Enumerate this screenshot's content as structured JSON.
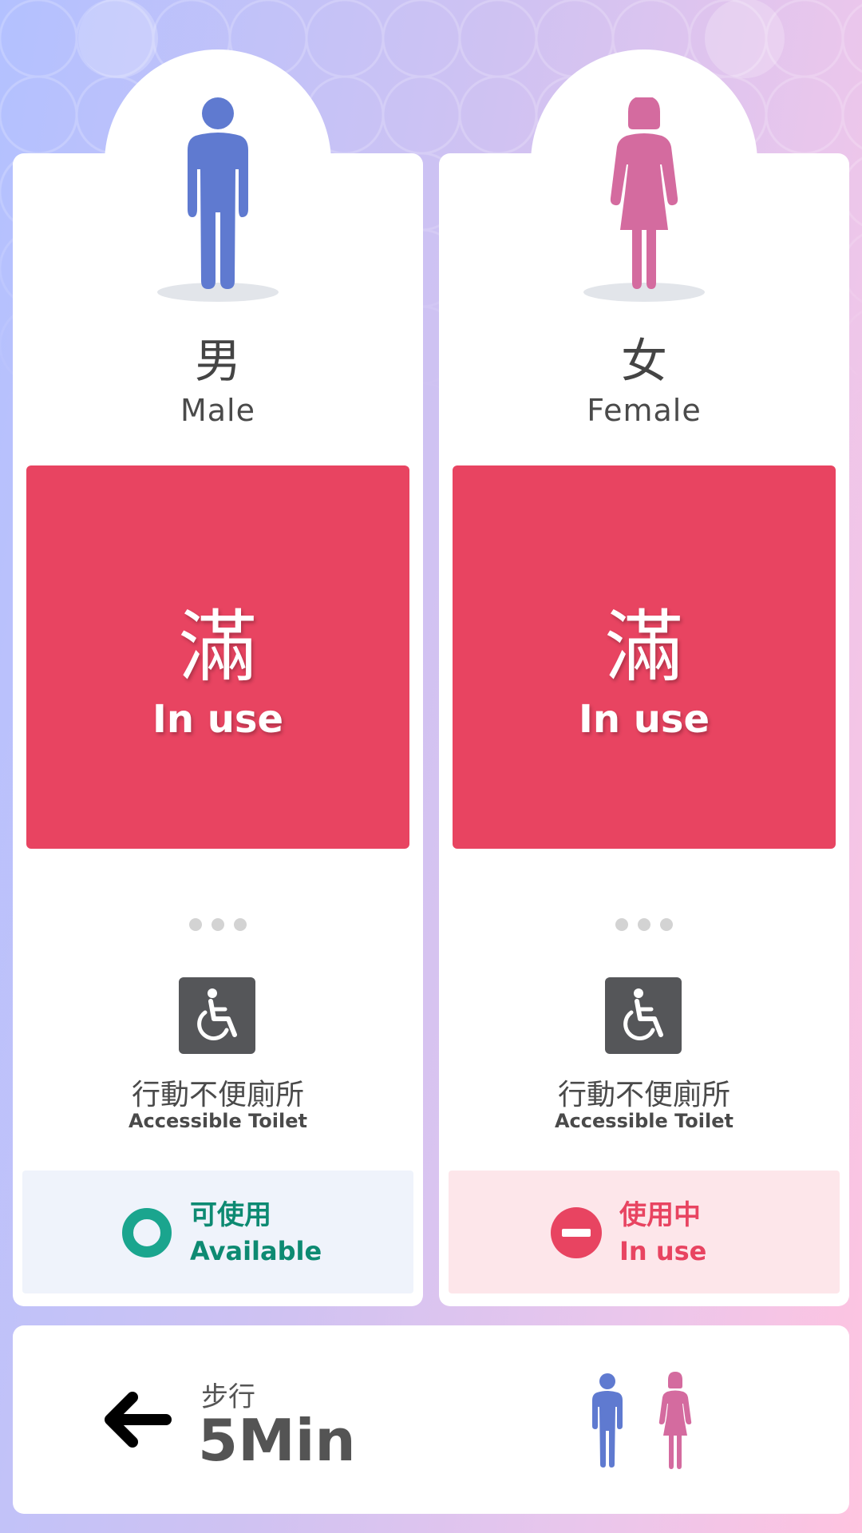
{
  "colors": {
    "male": "#5f7ad0",
    "female": "#d46b9f",
    "occupied": "#e84461",
    "available": "#1aa58e",
    "available_text": "#0d8a72",
    "available_bg": "#eff3fb",
    "inuse_bg": "#fde6ea"
  },
  "male": {
    "icon": "male-figure-icon",
    "label_zh": "男",
    "label_en": "Male",
    "status_zh": "滿",
    "status_en": "In use",
    "accessible_icon": "wheelchair-icon",
    "accessible_zh": "行動不便廁所",
    "accessible_en": "Accessible Toilet",
    "accessible_status_icon": "available-ring-icon",
    "accessible_status_zh": "可使用",
    "accessible_status_en": "Available"
  },
  "female": {
    "icon": "female-figure-icon",
    "label_zh": "女",
    "label_en": "Female",
    "status_zh": "滿",
    "status_en": "In use",
    "accessible_icon": "wheelchair-icon",
    "accessible_zh": "行動不便廁所",
    "accessible_en": "Accessible Toilet",
    "accessible_status_icon": "no-entry-icon",
    "accessible_status_zh": "使用中",
    "accessible_status_en": "In use"
  },
  "directions": {
    "arrow_icon": "left-arrow-icon",
    "walk_zh": "步行",
    "walk_time": "5Min"
  }
}
